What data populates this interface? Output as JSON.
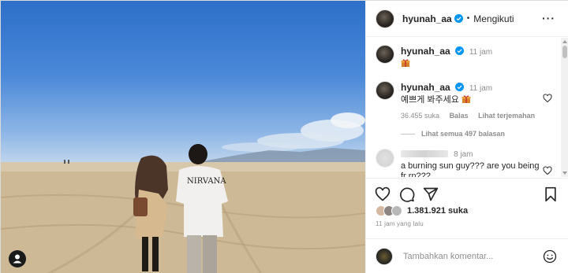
{
  "post": {
    "username": "hyunah_aa",
    "follow_status": "Mengikuti",
    "caption_time": "11 jam",
    "caption_emoji": "gift-icon"
  },
  "comments": [
    {
      "username": "hyunah_aa",
      "time": "11 jam",
      "text": "예쁘게 봐주세요",
      "likes": "36.455 suka",
      "reply_label": "Balas",
      "translate_label": "Lihat terjemahan"
    },
    {
      "username": "",
      "time": "8 jam",
      "text": "a burning sun guy??? are you being fr rn???"
    }
  ],
  "view_replies": "Lihat semua 497 balasan",
  "likes_count": "1.381.921 suka",
  "posted_ago": "11 jam yang lalu",
  "comment_placeholder": "Tambahkan komentar...",
  "colors": {
    "verified": "#0095f6",
    "muted": "#8e8e8e",
    "text": "#262626"
  }
}
